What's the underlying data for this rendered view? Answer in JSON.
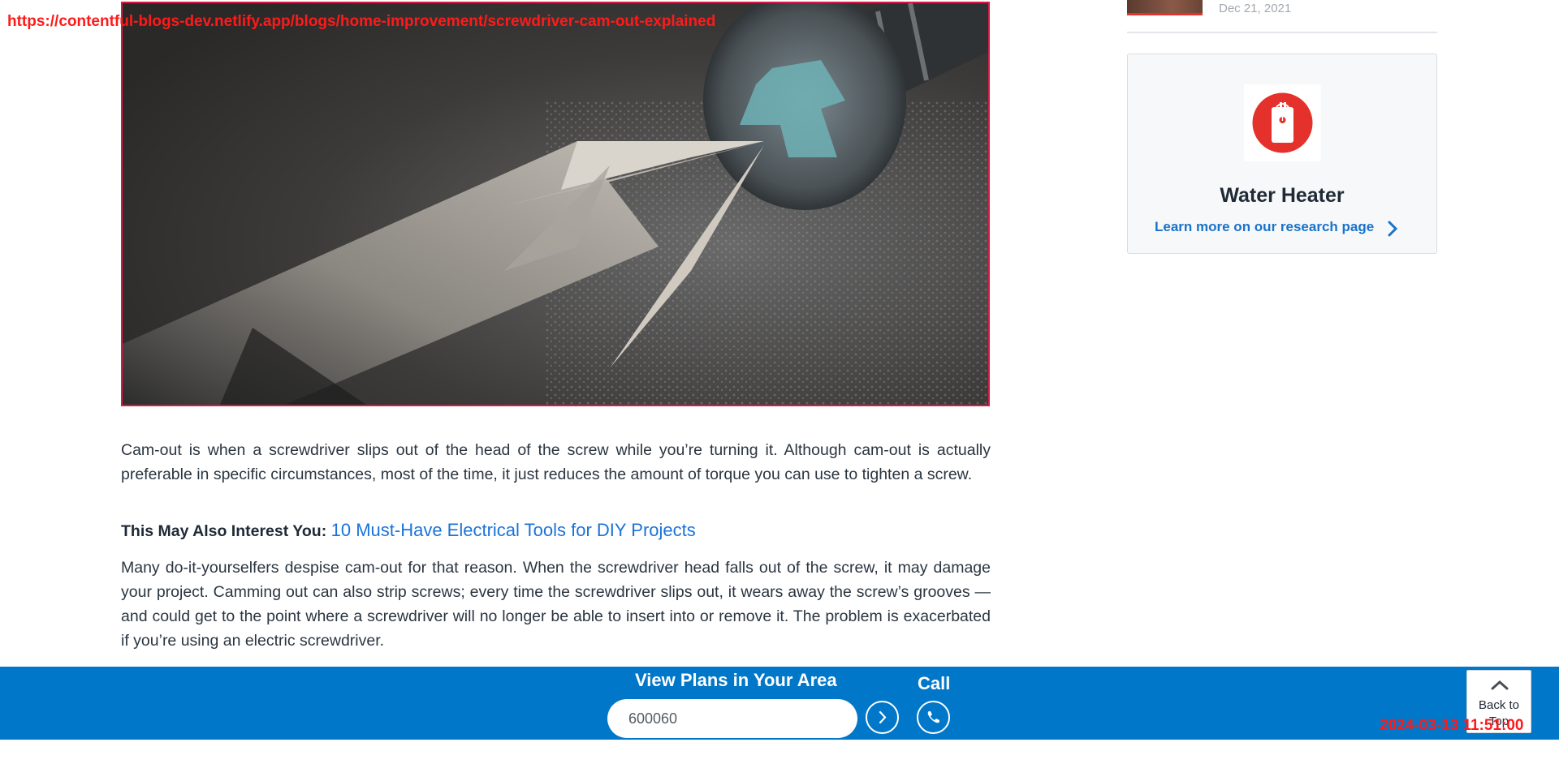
{
  "overlay": {
    "url": "https://contentful-blogs-dev.netlify.app/blogs/home-improvement/screwdriver-cam-out-explained",
    "timestamp": "2024-03-13 11:51:00"
  },
  "article": {
    "hero_alt": "Screwdriver bit slipping out of a screw head",
    "paragraph_1": "Cam-out is when a screwdriver slips out of the head of the screw while you’re turning it. Although cam-out is actually preferable in specific circumstances, most of the time, it just reduces the amount of torque you can use to tighten a screw.",
    "interest_label": "This May Also Interest You:",
    "interest_link": "10 Must-Have Electrical Tools for DIY Projects",
    "paragraph_2": "Many do-it-yourselfers despise cam-out for that reason. When the screwdriver head falls out of the screw, it may damage your project. Camming out can also strip screws; every time the screwdriver slips out, it wears away the screw’s grooves — and could get to the point where a screwdriver will no longer be able to insert into or remove it. The problem is exacerbated if you’re using an electric screwdriver."
  },
  "sidebar": {
    "post_date": "Dec 21, 2021",
    "card": {
      "title": "Water Heater",
      "link": "Learn more on our research page",
      "icon": "water-heater-icon",
      "icon_color": "#e4312b"
    }
  },
  "bottom_bar": {
    "heading": "View Plans in Your Area",
    "zip_value": "600060",
    "call_label": "Call",
    "back_to_top": "Back to Top",
    "bg_color": "#0077c8"
  }
}
